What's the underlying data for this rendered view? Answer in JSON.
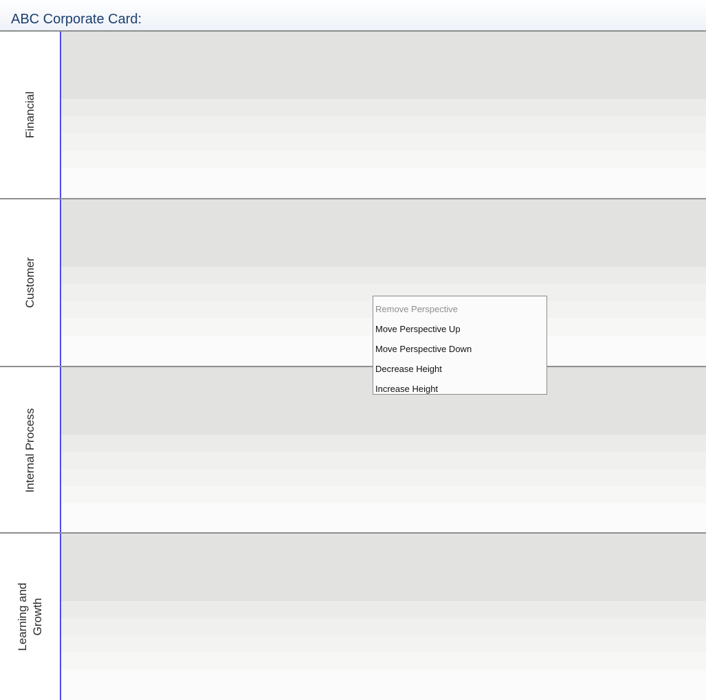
{
  "header": {
    "title": "ABC Corporate Card:"
  },
  "perspectives": [
    {
      "label": "Financial"
    },
    {
      "label": "Customer"
    },
    {
      "label": "Internal Process"
    },
    {
      "label": "Learning and Growth"
    }
  ],
  "context_menu": {
    "items": [
      {
        "label": "Remove Perspective",
        "enabled": false
      },
      {
        "label": "Move Perspective Up",
        "enabled": true
      },
      {
        "label": "Move Perspective Down",
        "enabled": true
      },
      {
        "label": "Decrease Height",
        "enabled": true
      },
      {
        "label": "Increase Height",
        "enabled": true
      }
    ]
  },
  "colors": {
    "title": "#1b3f6e",
    "lane_divider": "#4a4af0",
    "lane_border": "#8e8e8e"
  }
}
